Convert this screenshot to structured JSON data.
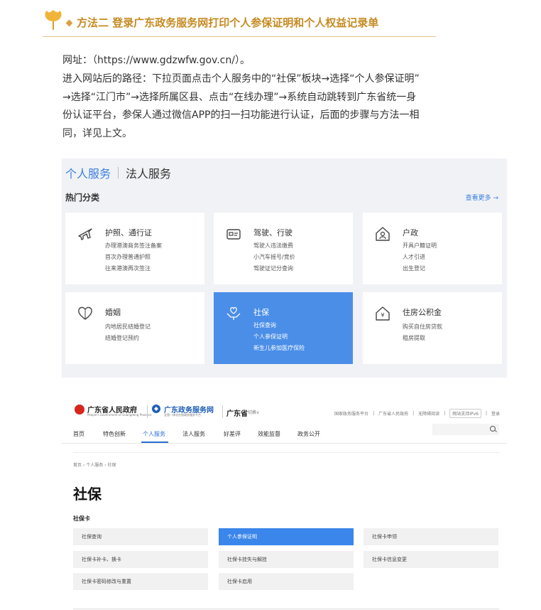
{
  "heading": {
    "title": "方法二 登录广东政务服务网打印个人参保证明和个人权益记录单"
  },
  "article": {
    "url_line": "网址：（https://www.gdzwfw.gov.cn/）。",
    "path_line_1": "进入网站后的路径：下拉页面点击个人服务中的“社保”板块→选择“个人参保证明”",
    "path_line_2": "→选择“江门市”→选择所属区县、点击“在线办理”→系统自动跳转到广东省统一身",
    "path_line_3": "份认证平台，参保人通过微信APP的扫一扫功能进行认证，后面的步骤与方法一相",
    "path_line_4": "同，详见上文。"
  },
  "screenshot1": {
    "tab_personal": "个人服务",
    "tab_legal": "法人服务",
    "hot_title": "热门分类",
    "more": "查看更多 →",
    "cards": [
      {
        "title": "护照、通行证",
        "icon": "plane-icon",
        "subs": [
          "办理港澳商务签注备案",
          "首次办理普通护照",
          "往来港澳再次签注"
        ]
      },
      {
        "title": "驾驶、行驶",
        "icon": "license-icon",
        "subs": [
          "驾驶人违法缴费",
          "小汽车摇号/竞价",
          "驾驶证记分查询"
        ]
      },
      {
        "title": "户政",
        "icon": "house-person-icon",
        "subs": [
          "开具户籍证明",
          "人才引进",
          "出生登记"
        ]
      },
      {
        "title": "婚姻",
        "icon": "heart-icon",
        "subs": [
          "内地居民结婚登记",
          "结婚登记预约"
        ]
      },
      {
        "title": "社保",
        "icon": "care-hands-icon",
        "subs": [
          "社保查询",
          "个人参保证明",
          "新生儿参加医疗保险"
        ]
      },
      {
        "title": "住房公积金",
        "icon": "yuan-house-icon",
        "subs": [
          "购买自住房贷款",
          "租房提取"
        ]
      }
    ]
  },
  "screenshot2": {
    "gov_name": "广东省人民政府",
    "gov_en": "People's Government of Guangdong Province",
    "site_name": "广东政务服务网",
    "site_sub": "全国一体化在线政务服务平台",
    "province": "广东省",
    "switch": "切换∨",
    "top_links": [
      "国家政务服务平台",
      "广东省人民政府",
      "无障碍阅读",
      "网站支持IPv6",
      "登录"
    ],
    "nav": [
      "首页",
      "特色创新",
      "个人服务",
      "法人服务",
      "好差评",
      "效能监督",
      "政务公开"
    ],
    "breadcrumb": "首页 ›  个人服务  ›  社保",
    "page_title": "社保",
    "section": "社保卡",
    "buttons": [
      "社保查询",
      "个人参保证明",
      "社保卡申领",
      "社保卡补卡、换卡",
      "社保卡挂失与解挂",
      "社保卡信息变更",
      "社保卡密码修改与重置",
      "社保卡启用"
    ]
  },
  "colors": {
    "accent_gold": "#c58a21",
    "brand_blue": "#3a86ea",
    "gov_red": "#d8261d"
  }
}
